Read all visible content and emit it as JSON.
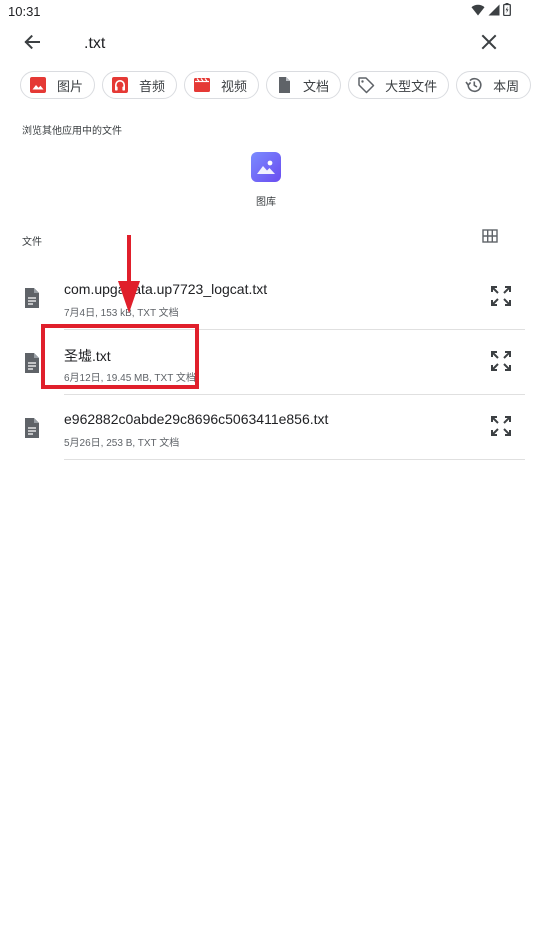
{
  "status_bar": {
    "time": "10:31",
    "icons": [
      "wifi-icon",
      "signal-icon",
      "battery-icon"
    ]
  },
  "search": {
    "query": ".txt",
    "back_icon": "arrow-left-icon",
    "clear_icon": "close-icon"
  },
  "chips": [
    {
      "label": "图片",
      "icon": "image-icon",
      "color": "#e53935"
    },
    {
      "label": "音频",
      "icon": "headphones-icon",
      "color": "#e53935"
    },
    {
      "label": "视频",
      "icon": "video-icon",
      "color": "#e53935"
    },
    {
      "label": "文档",
      "icon": "document-icon",
      "color": "#5f6368"
    },
    {
      "label": "大型文件",
      "icon": "tag-icon",
      "color": "#5f6368"
    },
    {
      "label": "本周",
      "icon": "history-icon",
      "color": "#5f6368"
    }
  ],
  "apps_section": {
    "title": "浏览其他应用中的文件",
    "apps": [
      {
        "label": "图库",
        "icon": "gallery-icon"
      }
    ]
  },
  "files_section": {
    "title": "文件",
    "view_toggle_icon": "grid-view-icon",
    "files": [
      {
        "name": "com.upgadata.up7723_logcat.txt",
        "meta": "7月4日, 153 kB, TXT 文档"
      },
      {
        "name": "圣墟.txt",
        "meta": "6月12日, 19.45 MB, TXT 文档"
      },
      {
        "name": "e962882c0abde29c8696c5063411e856.txt",
        "meta": "5月26日, 253 B, TXT 文档"
      }
    ]
  },
  "annotation": {
    "color": "#e01f2b"
  }
}
